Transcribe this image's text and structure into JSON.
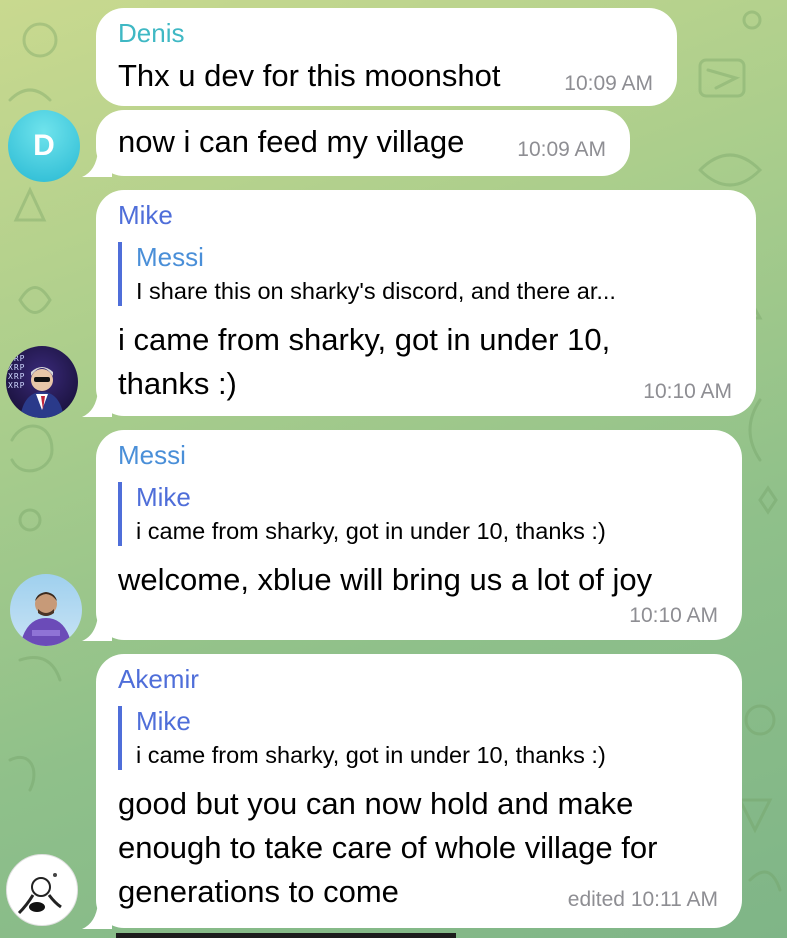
{
  "theme": {
    "sender_colors": {
      "Denis": "#3fb8c4",
      "Mike": "#4f6ed9",
      "Messi": "#4a8fd8",
      "Akemir": "#4f6ed9"
    },
    "reply_bar_color": "#4f6ed9",
    "time_color": "#8e8e93"
  },
  "avatars": {
    "denis_letter": "D",
    "mike_text": "XRP\nXRP\nXRP\nXRP"
  },
  "messages": [
    {
      "sender": "Denis",
      "text": "Thx u dev for this moonshot",
      "time": "10:09 AM"
    },
    {
      "text": "now i can feed my village",
      "time": "10:09 AM"
    },
    {
      "sender": "Mike",
      "reply": {
        "name": "Messi",
        "text": "I share this on sharky's discord, and there ar..."
      },
      "text": "i came from sharky, got in under 10,\nthanks :)",
      "time": "10:10 AM"
    },
    {
      "sender": "Messi",
      "reply": {
        "name": "Mike",
        "text": "i came from sharky, got in under 10, thanks :)"
      },
      "text": "welcome, xblue will bring us a lot of joy",
      "time": "10:10 AM"
    },
    {
      "sender": "Akemir",
      "reply": {
        "name": "Mike",
        "text": "i came from sharky, got in under 10, thanks :)"
      },
      "text": "good but you can now hold and make\nenough to take care of whole village for\ngenerations to come",
      "time": "edited 10:11 AM"
    }
  ]
}
